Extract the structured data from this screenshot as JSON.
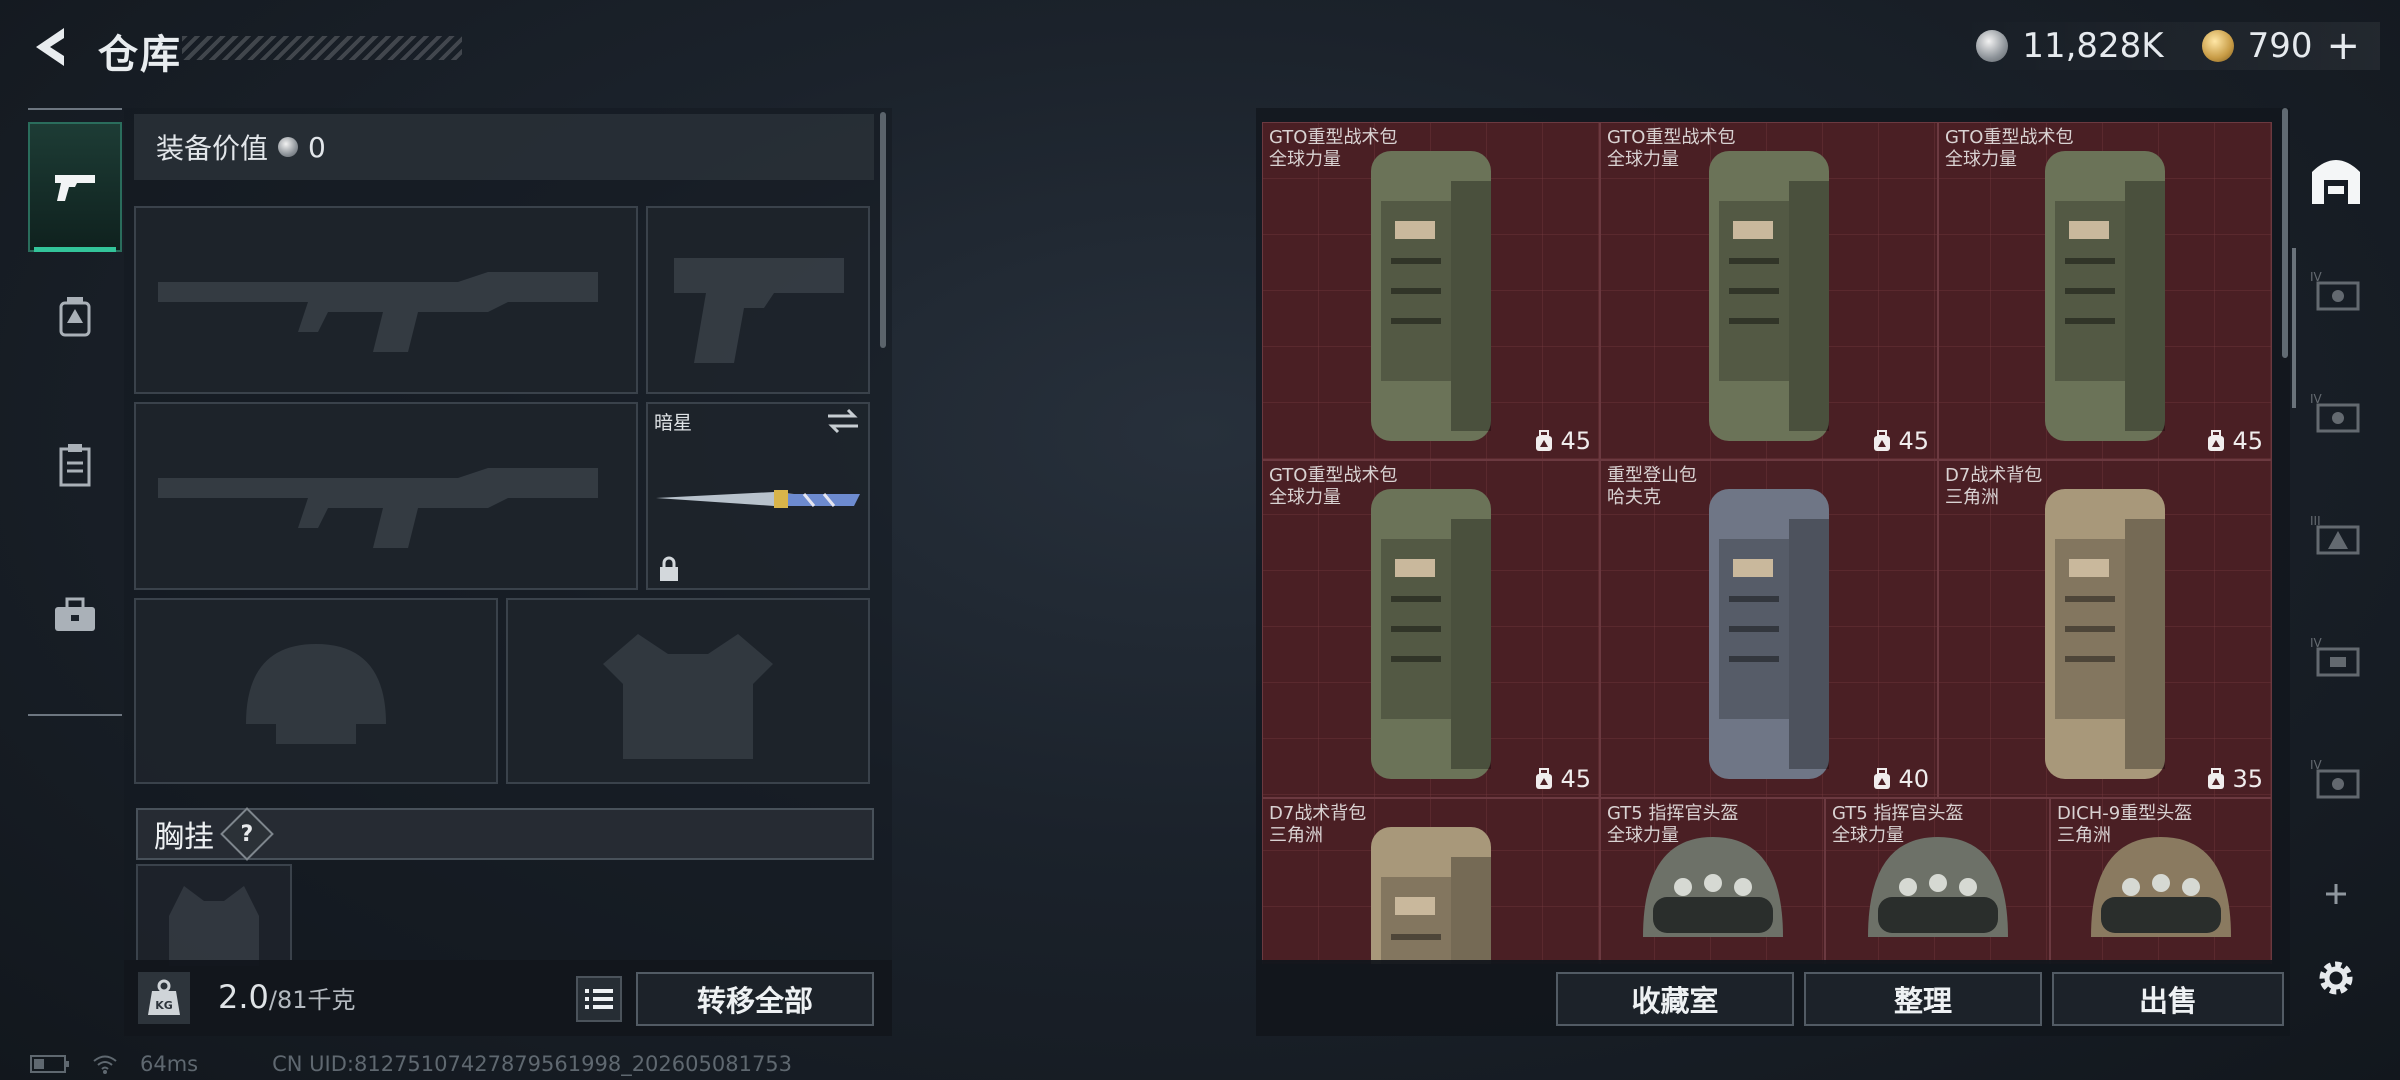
{
  "header": {
    "title": "仓库",
    "silver": "11,828K",
    "gold": "790",
    "gold_plus": "+"
  },
  "left_tabs": [
    {
      "name": "weapons",
      "icon": "pistol-icon",
      "active": true
    },
    {
      "name": "gear",
      "icon": "backpack-tab-icon"
    },
    {
      "name": "consumables",
      "icon": "clipboard-icon"
    },
    {
      "name": "tools",
      "icon": "toolbox-icon"
    }
  ],
  "equipment": {
    "value_label": "装备价值",
    "value": "0",
    "secondary_label": "暗星",
    "chest_label": "胸挂",
    "chest_help": "?",
    "weight_current": "2.0",
    "weight_max": "/81千克",
    "transfer_all": "转移全部"
  },
  "inventory": {
    "items": [
      {
        "name": "GTO重型战术包",
        "brand": "全球力量",
        "count": "45",
        "color": "#6b7358"
      },
      {
        "name": "GTO重型战术包",
        "brand": "全球力量",
        "count": "45",
        "color": "#6b7358"
      },
      {
        "name": "GTO重型战术包",
        "brand": "全球力量",
        "count": "45",
        "color": "#6b7358"
      },
      {
        "name": "GTO重型战术包",
        "brand": "全球力量",
        "count": "45",
        "color": "#6b7358"
      },
      {
        "name": "重型登山包",
        "brand": "哈夫克",
        "count": "40",
        "color": "#6f7686"
      },
      {
        "name": "D7战术背包",
        "brand": "三角洲",
        "count": "35",
        "color": "#a8987a"
      },
      {
        "name": "D7战术背包",
        "brand": "三角洲",
        "count": "",
        "color": "#a8987a"
      },
      {
        "name": "GT5 指挥官头盔",
        "brand": "全球力量",
        "count": "",
        "color": "#6d7168"
      },
      {
        "name": "GT5 指挥官头盔",
        "brand": "全球力量",
        "count": "",
        "color": "#6d7168"
      },
      {
        "name": "DICH-9重型头盔",
        "brand": "三角洲",
        "count": "",
        "color": "#8a7a60"
      }
    ],
    "buttons": {
      "collection": "收藏室",
      "sort": "整理",
      "sell": "出售"
    }
  },
  "status": {
    "ping": "64ms",
    "uid": "CN UID:81275107427879561998_202605081753"
  }
}
